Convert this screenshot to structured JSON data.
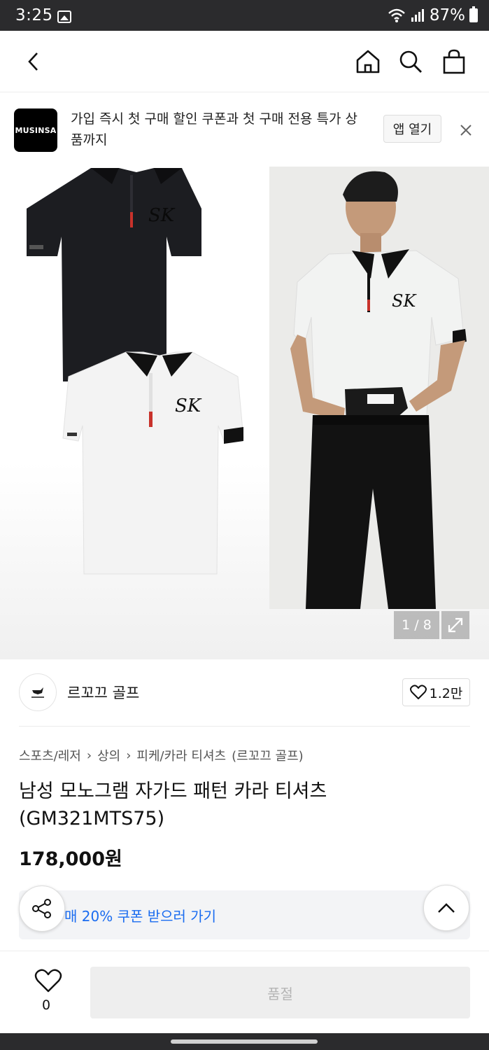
{
  "status_bar": {
    "time": "3:25",
    "battery": "87%"
  },
  "banner": {
    "logo_text": "MUSINSA",
    "message": "가입 즉시 첫 구매 할인 쿠폰과 첫 구매 전용 특가 상품까지",
    "open_app_label": "앱 열기"
  },
  "gallery": {
    "page_indicator": "1 / 8"
  },
  "brand": {
    "name": "르꼬끄 골프",
    "likes": "1.2만"
  },
  "breadcrumb": [
    "스포츠/레저",
    "상의",
    "피케/카라 티셔츠",
    "(르꼬끄 골프)"
  ],
  "product": {
    "title": "남성 모노그램 자가드 패턴 카라 티셔츠 (GM321MTS75)",
    "price": "178,000원"
  },
  "coupon": {
    "text": "매 20% 쿠폰 받으러 가기"
  },
  "bottom": {
    "wish_count": "0",
    "buy_label": "품절"
  },
  "colors": {
    "accent_blue": "#1a6cf0",
    "status_bar": "#2b2b2d",
    "soldout_bg": "#eeeeee"
  }
}
